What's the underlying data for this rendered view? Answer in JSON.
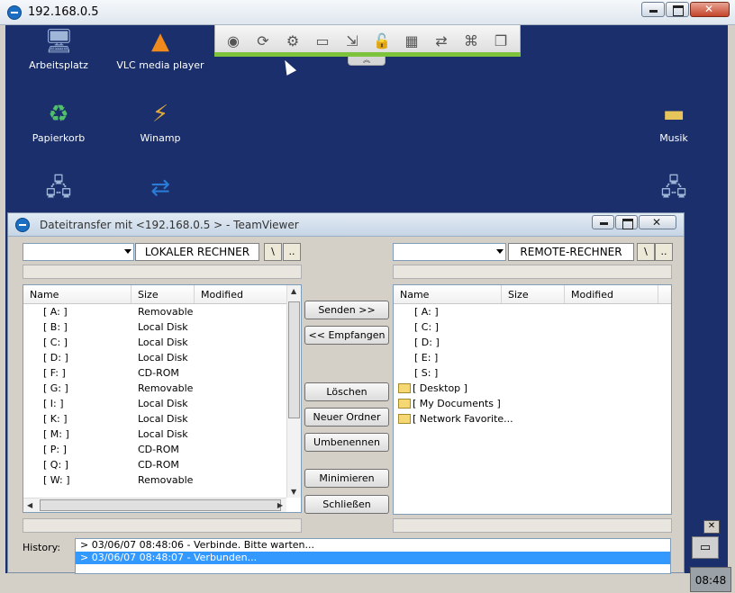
{
  "window": {
    "title": "192.168.0.5"
  },
  "desktop": {
    "icons": [
      {
        "label": "Arbeitsplatz",
        "glyph": "computer-icon"
      },
      {
        "label": "VLC media player",
        "glyph": "vlc-icon"
      },
      {
        "label": "Papierkorb",
        "glyph": "recycle-bin-icon"
      },
      {
        "label": "Winamp",
        "glyph": "winamp-icon"
      },
      {
        "label": "Musik",
        "glyph": "folder-icon"
      }
    ],
    "clock": "08:48"
  },
  "toolbar": {
    "items": [
      "record-icon",
      "refresh-icon",
      "settings-icon",
      "chat-icon",
      "file-transfer-icon",
      "lock-icon",
      "windows-icon",
      "switch-icon",
      "ctrl-alt-del-icon",
      "window-icon"
    ]
  },
  "file_transfer": {
    "title": "Dateitransfer mit  <192.168.0.5 >  -  TeamViewer",
    "local_label": "LOKALER RECHNER",
    "remote_label": "REMOTE-RECHNER",
    "root_label": "\\",
    "up_label": "..",
    "columns": {
      "name": "Name",
      "size": "Size",
      "modified": "Modified"
    },
    "local_items": [
      {
        "name": "[ A: ]",
        "size": "Removable"
      },
      {
        "name": "[ B: ]",
        "size": "Local Disk"
      },
      {
        "name": "[ C: ]",
        "size": "Local Disk"
      },
      {
        "name": "[ D: ]",
        "size": "Local Disk"
      },
      {
        "name": "[ F: ]",
        "size": "CD-ROM"
      },
      {
        "name": "[ G: ]",
        "size": "Removable"
      },
      {
        "name": "[ I: ]",
        "size": "Local Disk"
      },
      {
        "name": "[ K: ]",
        "size": "Local Disk"
      },
      {
        "name": "[ M: ]",
        "size": "Local Disk"
      },
      {
        "name": "[ P: ]",
        "size": "CD-ROM"
      },
      {
        "name": "[ Q: ]",
        "size": "CD-ROM"
      },
      {
        "name": "[ W: ]",
        "size": "Removable"
      }
    ],
    "remote_items": [
      {
        "name": "[ A: ]",
        "folder": false
      },
      {
        "name": "[ C: ]",
        "folder": false
      },
      {
        "name": "[ D: ]",
        "folder": false
      },
      {
        "name": "[ E: ]",
        "folder": false
      },
      {
        "name": "[ S: ]",
        "folder": false
      },
      {
        "name": "[ Desktop ]",
        "folder": true
      },
      {
        "name": "[ My Documents ]",
        "folder": true
      },
      {
        "name": "[ Network Favorite...",
        "folder": true
      }
    ],
    "buttons": {
      "send": "Senden >>",
      "receive": "<< Empfangen",
      "delete": "Löschen",
      "new_folder": "Neuer Ordner",
      "rename": "Umbenennen",
      "minimize": "Minimieren",
      "close": "Schließen"
    },
    "history_label": "History:",
    "history": [
      "> 03/06/07 08:48:06 - Verbinde. Bitte warten...",
      "> 03/06/07 08:48:07 - Verbunden..."
    ]
  }
}
